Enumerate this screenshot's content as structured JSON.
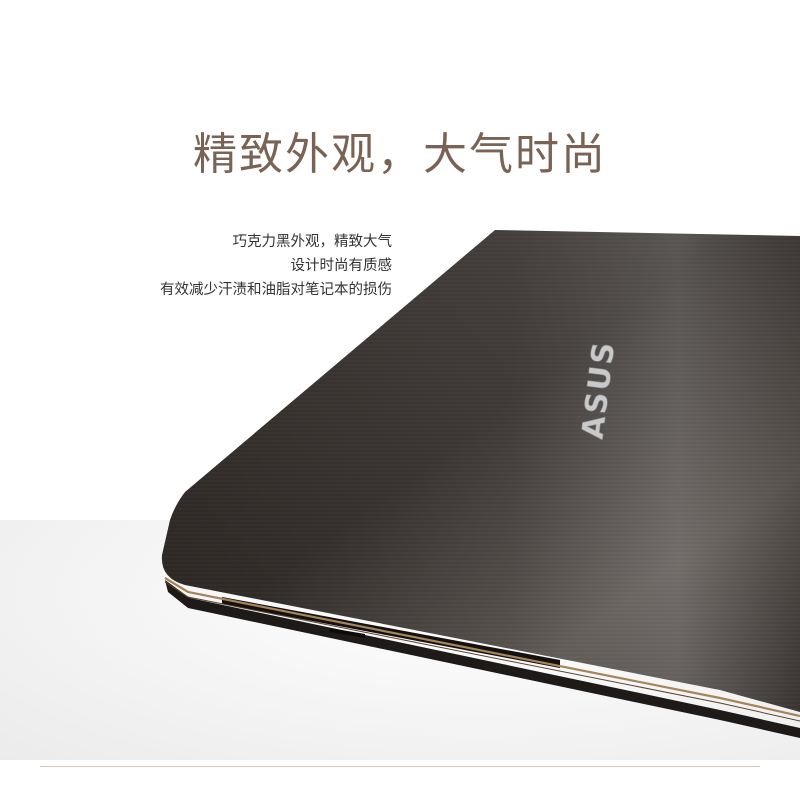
{
  "headline": "精致外观，大气时尚",
  "description": [
    "巧克力黑外观，精致大气",
    "设计时尚有质感",
    "有效减少汗渍和油脂对笔记本的损伤"
  ],
  "logo_text": "ASUS",
  "colors": {
    "headline": "#7a6354",
    "lid": "#2a2522",
    "gold_trim": "#a8845a",
    "rule": "#d9c6b0"
  }
}
